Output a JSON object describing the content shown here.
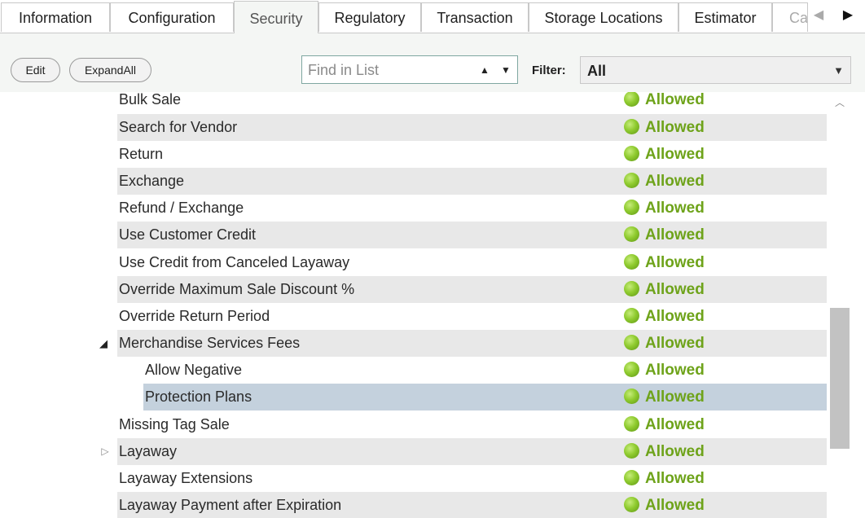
{
  "tabs": [
    {
      "label": "Information"
    },
    {
      "label": "Configuration"
    },
    {
      "label": "Security"
    },
    {
      "label": "Regulatory"
    },
    {
      "label": "Transaction"
    },
    {
      "label": "Storage Locations"
    },
    {
      "label": "Estimator"
    },
    {
      "label": "Ca"
    }
  ],
  "active_tab": "Security",
  "toolbar": {
    "edit_label": "Edit",
    "expand_all_label": "ExpandAll",
    "find_placeholder": "Find in List",
    "filter_label": "Filter:",
    "filter_value": "All"
  },
  "rows": [
    {
      "name": "Bulk Sale",
      "status": "Allowed"
    },
    {
      "name": "Search for Vendor",
      "status": "Allowed"
    },
    {
      "name": "Return",
      "status": "Allowed"
    },
    {
      "name": "Exchange",
      "status": "Allowed"
    },
    {
      "name": "Refund / Exchange",
      "status": "Allowed"
    },
    {
      "name": "Use Customer Credit",
      "status": "Allowed"
    },
    {
      "name": "Use Credit from Canceled Layaway",
      "status": "Allowed"
    },
    {
      "name": "Override Maximum Sale Discount %",
      "status": "Allowed"
    },
    {
      "name": "Override Return Period",
      "status": "Allowed"
    },
    {
      "name": "Merchandise Services Fees",
      "status": "Allowed"
    },
    {
      "name": "Allow Negative",
      "status": "Allowed"
    },
    {
      "name": "Protection Plans",
      "status": "Allowed"
    },
    {
      "name": "Missing Tag Sale",
      "status": "Allowed"
    },
    {
      "name": "Layaway",
      "status": "Allowed"
    },
    {
      "name": "Layaway Extensions",
      "status": "Allowed"
    },
    {
      "name": "Layaway Payment after Expiration",
      "status": "Allowed"
    }
  ],
  "colors": {
    "allowed_text": "#6ea31a",
    "selected_row": "#c4d1dd",
    "alt_row": "#e8e8e8"
  }
}
